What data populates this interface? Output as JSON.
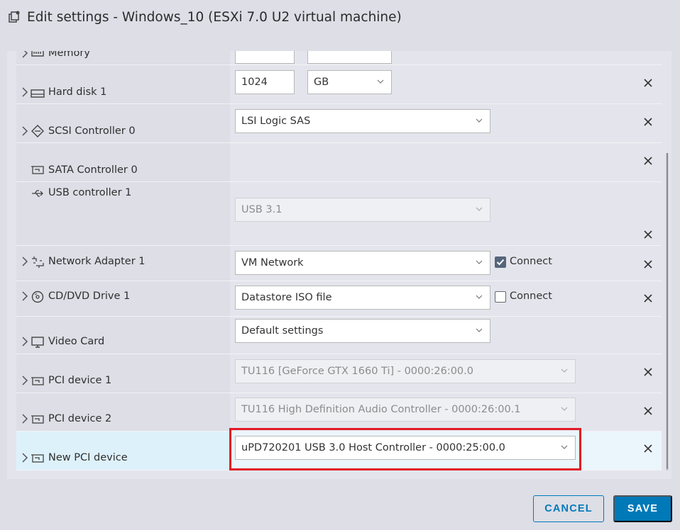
{
  "window": {
    "title": "Edit settings - Windows_10 (ESXi 7.0 U2 virtual machine)"
  },
  "devices": {
    "memory": {
      "label": "Memory"
    },
    "hard_disk": {
      "label": "Hard disk 1",
      "size": "1024",
      "unit": "GB"
    },
    "scsi": {
      "label": "SCSI Controller 0",
      "type": "LSI Logic SAS"
    },
    "sata": {
      "label": "SATA Controller 0"
    },
    "usb": {
      "label": "USB controller 1",
      "type": "USB 3.1"
    },
    "network": {
      "label": "Network Adapter 1",
      "network": "VM Network",
      "connect_label": "Connect",
      "connected": true
    },
    "cdrom": {
      "label": "CD/DVD Drive 1",
      "source": "Datastore ISO file",
      "connect_label": "Connect",
      "connected": false
    },
    "video": {
      "label": "Video Card",
      "setting": "Default settings"
    },
    "pci1": {
      "label": "PCI device 1",
      "device": "TU116 [GeForce GTX 1660 Ti] - 0000:26:00.0"
    },
    "pci2": {
      "label": "PCI device 2",
      "device": "TU116 High Definition Audio Controller - 0000:26:00.1"
    },
    "new_pci": {
      "label": "New PCI device",
      "device": "uPD720201 USB 3.0 Host Controller - 0000:25:00.0"
    }
  },
  "footer": {
    "cancel_label": "CANCEL",
    "save_label": "SAVE"
  },
  "colors": {
    "accent": "#0079b8",
    "highlight_box": "#e11a26",
    "selected_row": "#ddf1fb"
  }
}
